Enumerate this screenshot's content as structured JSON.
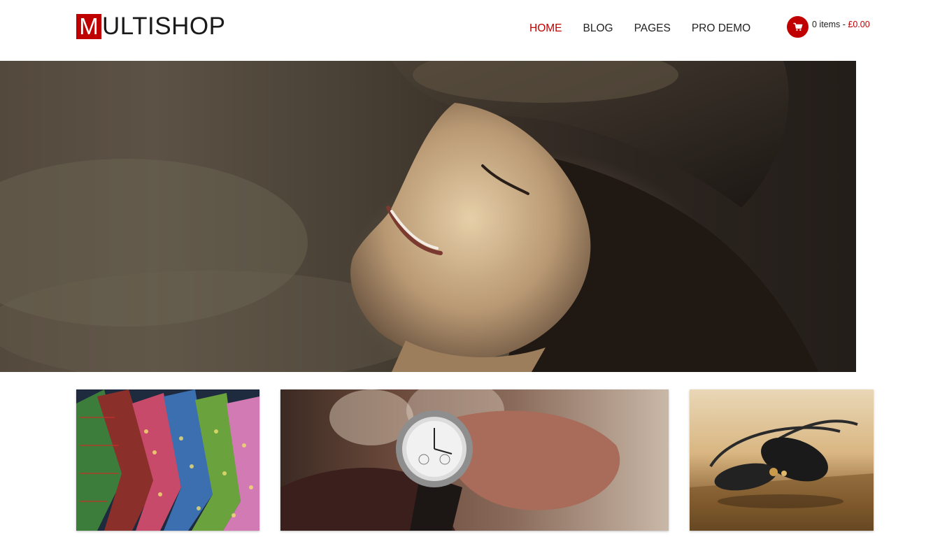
{
  "header": {
    "logo": {
      "initial": "M",
      "rest": "ULTISHOP"
    },
    "nav": [
      {
        "label": "HOME",
        "active": true
      },
      {
        "label": "BLOG",
        "active": false
      },
      {
        "label": "PAGES",
        "active": false
      },
      {
        "label": "PRO DEMO",
        "active": false
      }
    ],
    "cart": {
      "items_text": "0 items - ",
      "price": "£0.00",
      "icon": "shopping-cart-icon"
    }
  },
  "colors": {
    "accent": "#c00000",
    "text": "#222222",
    "background": "#ffffff"
  },
  "hero": {
    "image": "woman-in-hat-smiling-photo"
  },
  "tiles": [
    {
      "image": "colorful-neckties-photo"
    },
    {
      "image": "wristwatch-on-sleeve-photo"
    },
    {
      "image": "sunglasses-on-wood-photo"
    }
  ]
}
